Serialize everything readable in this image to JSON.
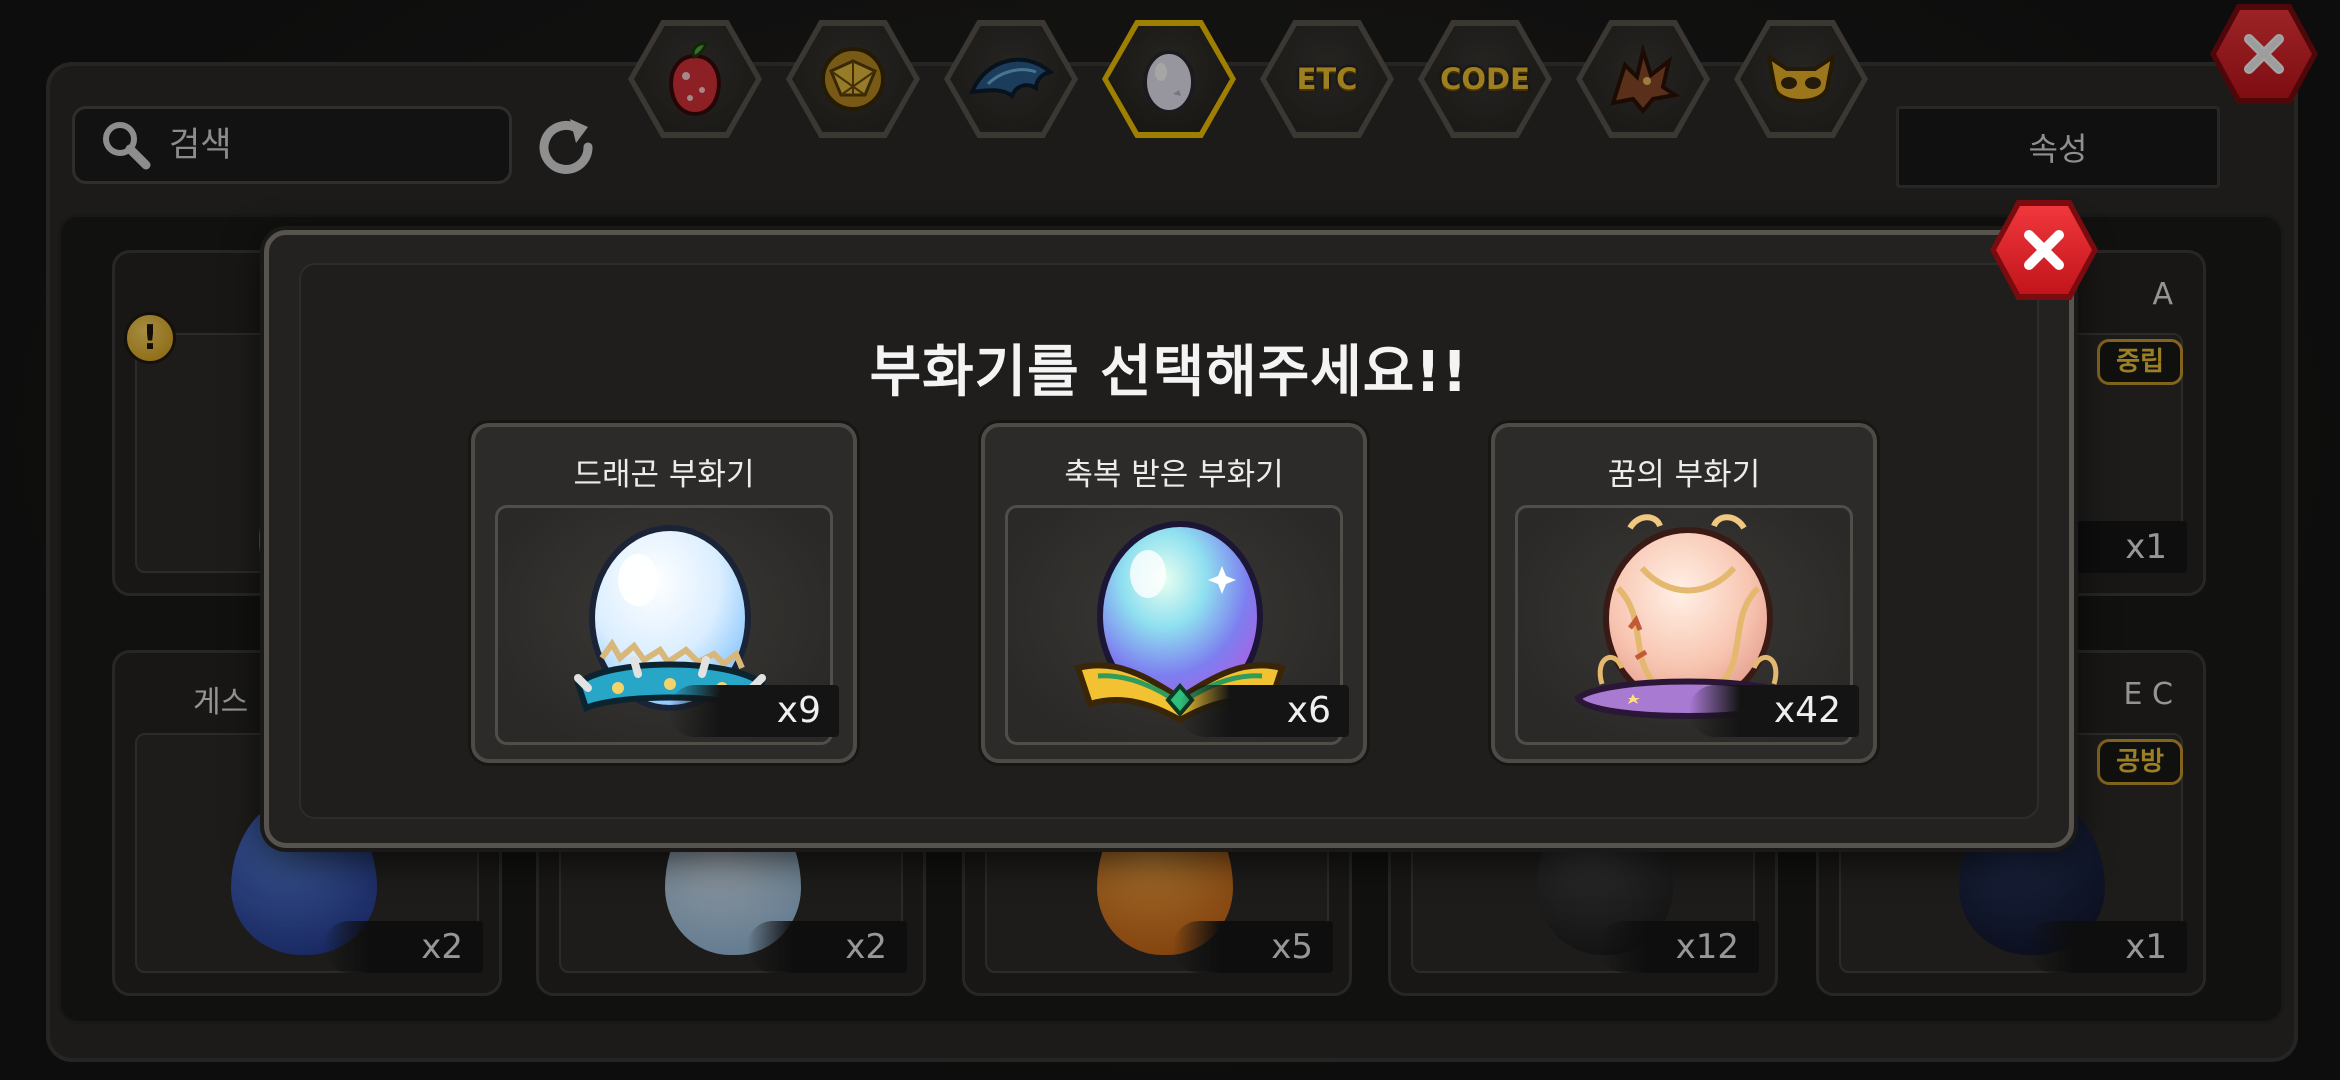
{
  "tabs": [
    {
      "name": "fruit",
      "icon": "fruit-icon",
      "label": ""
    },
    {
      "name": "gold-orb",
      "icon": "gold-orb-icon",
      "label": ""
    },
    {
      "name": "dragon-fin",
      "icon": "dragon-fin-icon",
      "label": ""
    },
    {
      "name": "egg",
      "icon": "egg-icon",
      "label": "",
      "active": true
    },
    {
      "name": "etc",
      "icon": "",
      "label": "ETC"
    },
    {
      "name": "code",
      "icon": "",
      "label": "CODE"
    },
    {
      "name": "dragon-emblem",
      "icon": "dragon-emblem-icon",
      "label": ""
    },
    {
      "name": "mask",
      "icon": "mask-icon",
      "label": ""
    }
  ],
  "search": {
    "placeholder": "검색"
  },
  "attribute_filter": {
    "label": "속성"
  },
  "background_cards": [
    {
      "title": "",
      "count": "",
      "tag": ""
    },
    {
      "title": "A",
      "count": "x1",
      "tag": "중립"
    },
    {
      "title": "게스",
      "count": "x2",
      "tag": ""
    },
    {
      "title": "",
      "count": "x2",
      "tag": ""
    },
    {
      "title": "",
      "count": "x5",
      "tag": ""
    },
    {
      "title": "",
      "count": "x12",
      "tag": ""
    },
    {
      "title": "E C",
      "count": "x1",
      "tag": "공방"
    }
  ],
  "modal": {
    "title": "부화기를 선택해주세요!!",
    "incubators": [
      {
        "name": "드래곤 부화기",
        "count": "x9"
      },
      {
        "name": "축복 받은 부화기",
        "count": "x6"
      },
      {
        "name": "꿈의 부화기",
        "count": "x42"
      }
    ]
  },
  "colors": {
    "accent_gold": "#f4c400",
    "close_red": "#d8191f",
    "panel": "#2b2a28",
    "modal_bg": "#232220"
  }
}
